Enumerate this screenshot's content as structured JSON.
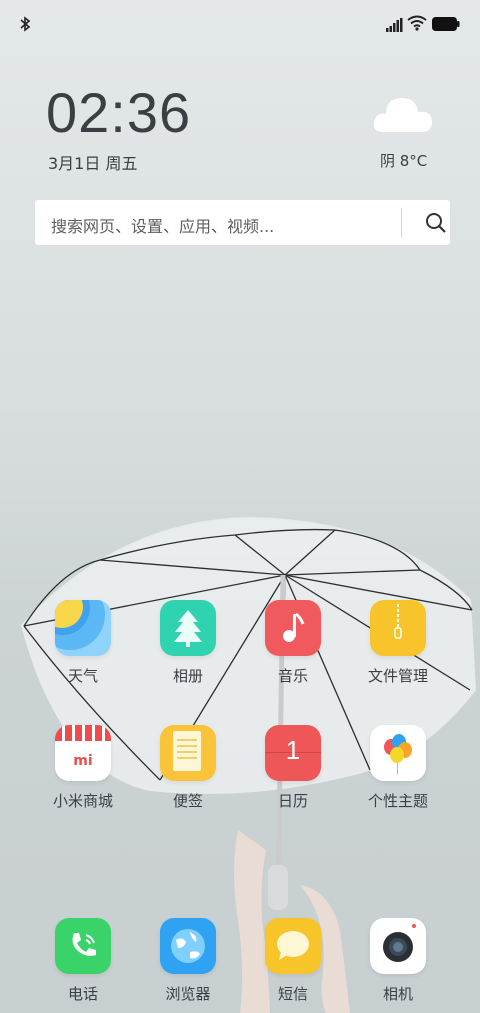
{
  "clock": {
    "time": "02:36",
    "date": "3月1日 周五"
  },
  "weather": {
    "text": "阴  8°C",
    "icon": "cloud-icon"
  },
  "search": {
    "placeholder": "搜索网页、设置、应用、视频..."
  },
  "apps_row1": [
    {
      "label": "天气",
      "icon": "weather-app-icon"
    },
    {
      "label": "相册",
      "icon": "gallery-app-icon"
    },
    {
      "label": "音乐",
      "icon": "music-app-icon"
    },
    {
      "label": "文件管理",
      "icon": "file-manager-app-icon"
    }
  ],
  "apps_row2": [
    {
      "label": "小米商城",
      "icon": "mi-store-app-icon"
    },
    {
      "label": "便签",
      "icon": "notes-app-icon"
    },
    {
      "label": "日历",
      "icon": "calendar-app-icon",
      "day": "1"
    },
    {
      "label": "个性主题",
      "icon": "themes-app-icon"
    }
  ],
  "dock": [
    {
      "label": "电话",
      "icon": "phone-app-icon"
    },
    {
      "label": "浏览器",
      "icon": "browser-app-icon"
    },
    {
      "label": "短信",
      "icon": "messages-app-icon"
    },
    {
      "label": "相机",
      "icon": "camera-app-icon"
    }
  ],
  "colors": {
    "weather": "#4aa8f0",
    "gallery": "#2fd3b0",
    "music": "#f05a5f",
    "files": "#f7c42b",
    "notes": "#f9c43a",
    "calendar": "#ef5658",
    "phone": "#39d36a",
    "browser": "#2fa3f2",
    "messages": "#f7c52a",
    "camera": "#ffffff"
  }
}
